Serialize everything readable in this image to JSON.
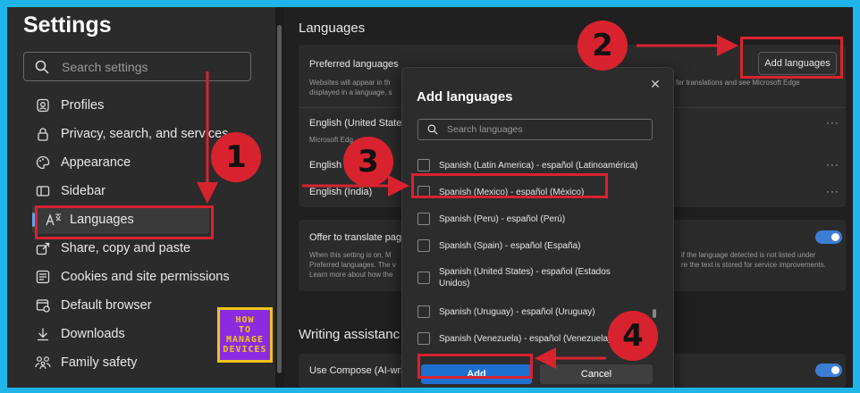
{
  "sidebar": {
    "title": "Settings",
    "search_placeholder": "Search settings",
    "items": [
      {
        "label": "Profiles",
        "icon": "profile-icon"
      },
      {
        "label": "Privacy, search, and services",
        "icon": "lock-icon"
      },
      {
        "label": "Appearance",
        "icon": "appearance-icon"
      },
      {
        "label": "Sidebar",
        "icon": "sidebar-icon"
      },
      {
        "label": "Languages",
        "icon": "languages-icon",
        "active": true
      },
      {
        "label": "Share, copy and paste",
        "icon": "share-icon"
      },
      {
        "label": "Cookies and site permissions",
        "icon": "cookies-icon"
      },
      {
        "label": "Default browser",
        "icon": "browser-icon"
      },
      {
        "label": "Downloads",
        "icon": "download-icon"
      },
      {
        "label": "Family safety",
        "icon": "family-icon"
      }
    ]
  },
  "main": {
    "languages_title": "Languages",
    "preferred_title": "Preferred languages",
    "preferred_desc_left": "Websites will appear in th",
    "preferred_desc_left2": "displayed in a language, s",
    "preferred_desc_right": "fer translations and see Microsoft Edge",
    "add_languages_label": "Add languages",
    "languages": [
      {
        "name": "English (United States",
        "sub": "Microsoft Edg"
      },
      {
        "name": "English",
        "sub": ""
      },
      {
        "name": "English (India)",
        "sub": ""
      }
    ],
    "more_label": "···",
    "offer_translate_title": "Offer to translate pag",
    "offer_desc_l1": "When this setting is on, M",
    "offer_desc_l2": "Preferred languages. The v",
    "offer_desc_l3": "Learn more about how the",
    "offer_desc_r1": "if the language detected is not listed under",
    "offer_desc_r2": "re the text is stored for service improvements.",
    "writing_title": "Writing assistanc",
    "compose_label": "Use Compose (AI-writ"
  },
  "dialog": {
    "title": "Add languages",
    "close_glyph": "✕",
    "search_placeholder": "Search languages",
    "options": [
      "Spanish (Latin America) - español (Latinoamérica)",
      "Spanish (Mexico) - español (México)",
      "Spanish (Peru) - español (Perú)",
      "Spanish (Spain) - español (España)",
      "Spanish (United States) - español (Estados Unidos)",
      "Spanish (Uruguay) - español (Uruguay)",
      "Spanish (Venezuela) - español (Venezuela)"
    ],
    "add_label": "Add",
    "cancel_label": "Cancel"
  },
  "annotations": {
    "badges": [
      "1",
      "2",
      "3",
      "4"
    ],
    "color": "#d8232f"
  },
  "logo": {
    "lines": [
      "HOW",
      "TO",
      "MANAGE",
      "DEVICES"
    ]
  },
  "colors": {
    "accent": "#1f6fd0",
    "toggle": "#3c7ed6",
    "frame": "#1fb5e8"
  }
}
